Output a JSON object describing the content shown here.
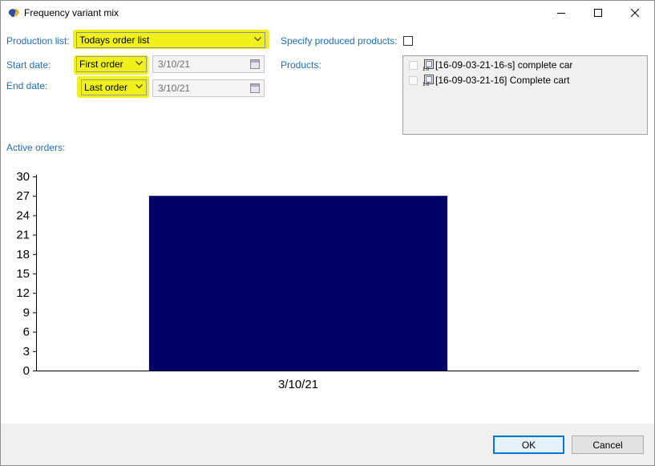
{
  "window": {
    "title": "Frequency variant mix",
    "minimize_icon": "minimize-icon",
    "maximize_icon": "maximize-icon",
    "close_icon": "close-icon"
  },
  "form": {
    "production_list_label": "Production list:",
    "production_list_value": "Todays order list",
    "start_date_label": "Start date:",
    "start_date_mode": "First order",
    "start_date_value": "3/10/21",
    "end_date_label": "End date:",
    "end_date_mode": "Last order",
    "end_date_value": "3/10/21",
    "specify_products_label": "Specify produced products:",
    "specify_products_checked": false,
    "products_label": "Products:",
    "products": [
      {
        "label": "[16-09-03-21-16-s] complete car",
        "checked": false
      },
      {
        "label": "[16-09-03-21-16] Complete cart",
        "checked": false
      }
    ],
    "active_orders_label": "Active orders:"
  },
  "colors": {
    "label_blue": "#1e6fc0",
    "highlight_yellow": "#f0f01a",
    "bar_navy": "#000066",
    "primary_button_border": "#0078d7"
  },
  "chart_data": {
    "type": "bar",
    "categories": [
      "3/10/21"
    ],
    "values": [
      27
    ],
    "title": "",
    "xlabel": "",
    "ylabel": "",
    "ylim": [
      0,
      30
    ],
    "yticks": [
      0,
      3,
      6,
      9,
      12,
      15,
      18,
      21,
      24,
      27,
      30
    ],
    "grid": false,
    "legend": "none"
  },
  "buttons": {
    "ok": "OK",
    "cancel": "Cancel"
  }
}
